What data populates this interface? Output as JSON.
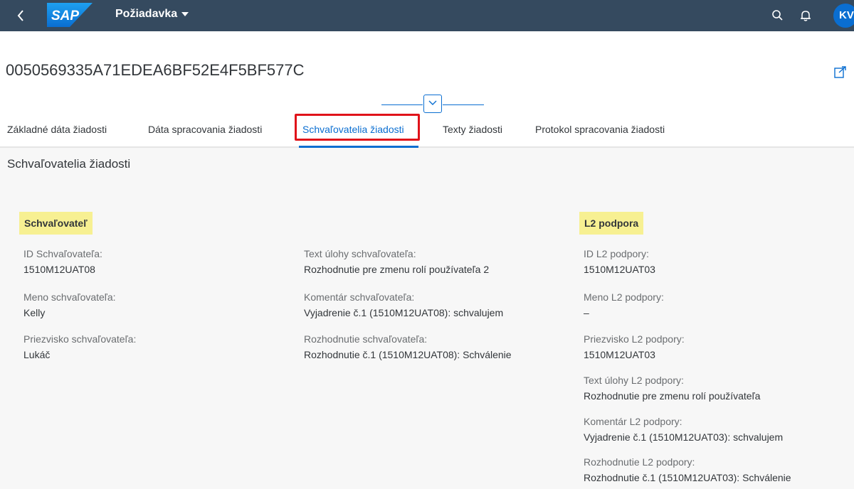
{
  "shell": {
    "app_title": "Požiadavka",
    "logo_text": "SAP",
    "avatar_initials": "KV"
  },
  "header": {
    "object_id": "0050569335A71EDEA6BF52E4F5BF577C"
  },
  "tabs": [
    {
      "label": "Základné dáta žiadosti"
    },
    {
      "label": "Dáta spracovania žiadosti"
    },
    {
      "label": "Schvaľovatelia žiadosti"
    },
    {
      "label": "Texty žiadosti"
    },
    {
      "label": "Protokol spracovania žiadosti"
    }
  ],
  "section": {
    "title": "Schvaľovatelia žiadosti"
  },
  "groups": {
    "approver": "Schvaľovateľ",
    "l2": "L2 podpora"
  },
  "fields": {
    "approver_id": {
      "label": "ID Schvaľovateľa:",
      "value": "1510M12UAT08"
    },
    "approver_first": {
      "label": "Meno schvaľovateľa:",
      "value": "Kelly"
    },
    "approver_last": {
      "label": "Priezvisko schvaľovateľa:",
      "value": "Lukáč"
    },
    "task_text": {
      "label": "Text úlohy schvaľovateľa:",
      "value": "Rozhodnutie pre zmenu rolí používateľa 2"
    },
    "approver_comment": {
      "label": "Komentár schvaľovateľa:",
      "value": "Vyjadrenie č.1 (1510M12UAT08):  schvalujem"
    },
    "approver_decision": {
      "label": "Rozhodnutie schvaľovateľa:",
      "value": "Rozhodnutie č.1 (1510M12UAT08): Schválenie"
    },
    "l2_id": {
      "label": "ID L2 podpory:",
      "value": "1510M12UAT03"
    },
    "l2_first": {
      "label": "Meno L2 podpory:",
      "value": "–"
    },
    "l2_last": {
      "label": "Priezvisko L2 podpory:",
      "value": "1510M12UAT03"
    },
    "l2_task": {
      "label": "Text úlohy L2 podpory:",
      "value": "Rozhodnutie pre zmenu rolí používateľa"
    },
    "l2_comment": {
      "label": "Komentár L2 podpory:",
      "value": "Vyjadrenie č.1 (1510M12UAT03):  schvalujem"
    },
    "l2_decision": {
      "label": "Rozhodnutie L2 podpory:",
      "value": "Rozhodnutie č.1 (1510M12UAT03): Schválenie"
    }
  },
  "colors": {
    "shell_bg": "#354a5f",
    "accent": "#0a6ed1",
    "highlight": "#f7f092",
    "annotation_red": "#e0131a"
  }
}
